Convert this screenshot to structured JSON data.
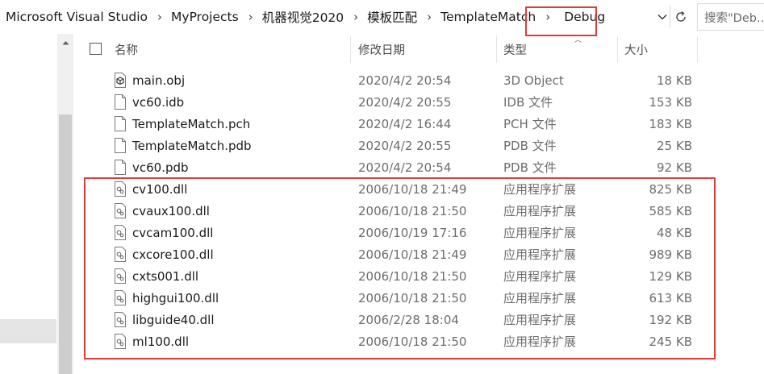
{
  "address": {
    "crumbs": [
      "Microsoft Visual Studio",
      "MyProjects",
      "机器视觉2020",
      "模板匹配",
      "TemplateMatch",
      "Debug"
    ],
    "separator": "›",
    "search_placeholder": "搜索\"Deb..."
  },
  "columns": {
    "name": "名称",
    "modified": "修改日期",
    "type": "类型",
    "size": "大小"
  },
  "files": [
    {
      "name": "main.obj",
      "modified": "2020/4/2 20:54",
      "type": "3D Object",
      "size": "18 KB",
      "icon": "3d-object-file-icon"
    },
    {
      "name": "vc60.idb",
      "modified": "2020/4/2 20:55",
      "type": "IDB 文件",
      "size": "153 KB",
      "icon": "blank-file-icon"
    },
    {
      "name": "TemplateMatch.pch",
      "modified": "2020/4/2 16:44",
      "type": "PCH 文件",
      "size": "183 KB",
      "icon": "blank-file-icon"
    },
    {
      "name": "TemplateMatch.pdb",
      "modified": "2020/4/2 20:55",
      "type": "PDB 文件",
      "size": "25 KB",
      "icon": "blank-file-icon"
    },
    {
      "name": "vc60.pdb",
      "modified": "2020/4/2 20:54",
      "type": "PDB 文件",
      "size": "92 KB",
      "icon": "blank-file-icon"
    },
    {
      "name": "cv100.dll",
      "modified": "2006/10/18 21:49",
      "type": "应用程序扩展",
      "size": "825 KB",
      "icon": "dll-file-icon"
    },
    {
      "name": "cvaux100.dll",
      "modified": "2006/10/18 21:50",
      "type": "应用程序扩展",
      "size": "585 KB",
      "icon": "dll-file-icon"
    },
    {
      "name": "cvcam100.dll",
      "modified": "2006/10/19 17:16",
      "type": "应用程序扩展",
      "size": "48 KB",
      "icon": "dll-file-icon"
    },
    {
      "name": "cxcore100.dll",
      "modified": "2006/10/18 21:49",
      "type": "应用程序扩展",
      "size": "989 KB",
      "icon": "dll-file-icon"
    },
    {
      "name": "cxts001.dll",
      "modified": "2006/10/18 21:50",
      "type": "应用程序扩展",
      "size": "129 KB",
      "icon": "dll-file-icon"
    },
    {
      "name": "highgui100.dll",
      "modified": "2006/10/18 21:50",
      "type": "应用程序扩展",
      "size": "613 KB",
      "icon": "dll-file-icon"
    },
    {
      "name": "libguide40.dll",
      "modified": "2006/2/28 18:04",
      "type": "应用程序扩展",
      "size": "192 KB",
      "icon": "dll-file-icon"
    },
    {
      "name": "ml100.dll",
      "modified": "2006/10/18 21:50",
      "type": "应用程序扩展",
      "size": "245 KB",
      "icon": "dll-file-icon"
    }
  ],
  "colors": {
    "annotation": "#e03b3b",
    "header_text": "#4d4d4d",
    "detail_text": "#6d6d6d"
  }
}
